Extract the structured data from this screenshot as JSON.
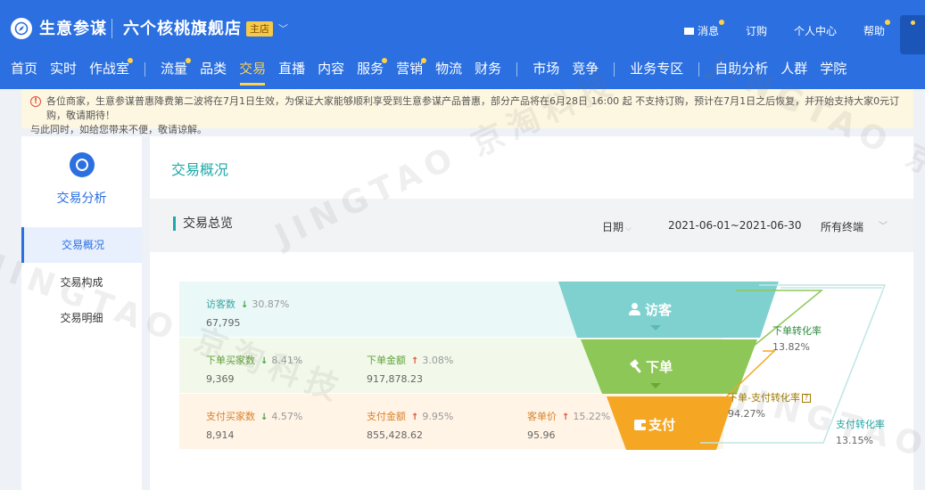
{
  "header": {
    "brand": "生意参谋",
    "shop_name": "六个核桃旗舰店",
    "shop_badge": "主店",
    "top_links": [
      {
        "label": "消息",
        "dot": true
      },
      {
        "label": "订购",
        "dot": false
      },
      {
        "label": "个人中心",
        "dot": false
      },
      {
        "label": "帮助",
        "dot": true
      }
    ],
    "nav": [
      "首页",
      "实时",
      "作战室",
      "流量",
      "品类",
      "交易",
      "直播",
      "内容",
      "服务",
      "营销",
      "物流",
      "财务",
      "市场",
      "竞争",
      "业务专区",
      "自助分析",
      "人群",
      "学院"
    ],
    "active_nav": "交易"
  },
  "notice": {
    "line1": "各位商家，生意参谋普惠降费第二波将在7月1日生效，为保证大家能够顺利享受到生意参谋产品普惠，部分产品将在6月28日 16:00 起 不支持订购，预计在7月1日之后恢复，并开始支持大家0元订购，敬请期待！",
    "line2": "与此同时，如给您带来不便，敬请谅解。"
  },
  "sidebar": {
    "title": "交易分析",
    "items": [
      {
        "label": "交易概况",
        "active": true
      },
      {
        "label": "交易构成",
        "active": false
      },
      {
        "label": "交易明细",
        "active": false
      }
    ]
  },
  "main": {
    "title": "交易概况",
    "section_title": "交易总览",
    "date_label": "日期",
    "date_range": "2021-06-01~2021-06-30",
    "terminal": "所有终端"
  },
  "funnel": {
    "visit": {
      "stage": "访客",
      "metrics": [
        {
          "label": "访客数",
          "change": "30.87%",
          "dir": "down",
          "value": "67,795"
        }
      ]
    },
    "order": {
      "stage": "下单",
      "metrics": [
        {
          "label": "下单买家数",
          "change": "8.41%",
          "dir": "down",
          "value": "9,369"
        },
        {
          "label": "下单金额",
          "change": "3.08%",
          "dir": "up",
          "value": "917,878.23"
        }
      ]
    },
    "pay": {
      "stage": "支付",
      "metrics": [
        {
          "label": "支付买家数",
          "change": "4.57%",
          "dir": "down",
          "value": "8,914"
        },
        {
          "label": "支付金额",
          "change": "9.95%",
          "dir": "up",
          "value": "855,428.62"
        },
        {
          "label": "客单价",
          "change": "15.22%",
          "dir": "up",
          "value": "95.96"
        }
      ]
    },
    "rates": {
      "order_rate": {
        "label": "下单转化率",
        "value": "13.82%"
      },
      "order_pay_rate": {
        "label": "下单-支付转化率",
        "value": "94.27%"
      },
      "pay_rate": {
        "label": "支付转化率",
        "value": "13.15%"
      }
    },
    "colors": {
      "visit": "#7fd1cf",
      "order": "#8dc757",
      "pay": "#f5a623",
      "rate_order": "#2d8a3e",
      "rate_order_pay": "#a07a00",
      "rate_pay": "#1fa9a7"
    }
  },
  "watermark": "JINGTAO 京淘科技"
}
